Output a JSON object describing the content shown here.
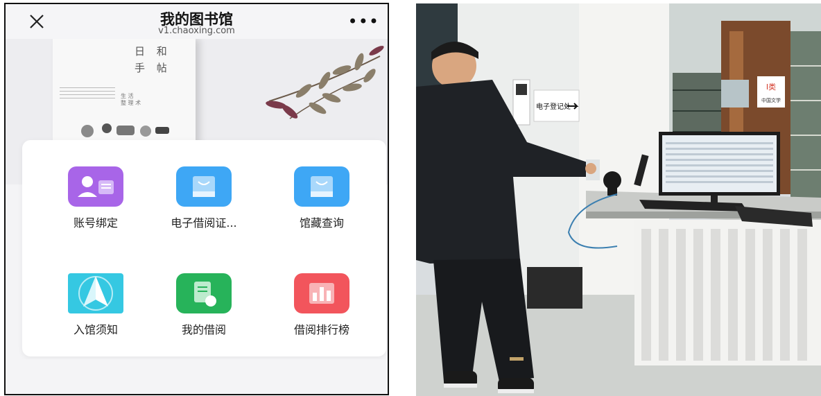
{
  "phone": {
    "title": "我的图书馆",
    "subtitle": "v1.chaoxing.com",
    "more": "•••",
    "banner": {
      "book_title_line1": "日 和",
      "book_title_line2": "手 帖",
      "book_side_line1": "生 活",
      "book_side_line2": "整 理 术"
    },
    "tiles": [
      {
        "label": "账号绑定",
        "icon": "account-bind-icon",
        "color": "#a865e8"
      },
      {
        "label": "电子借阅证...",
        "icon": "e-card-icon",
        "color": "#3ea7f5"
      },
      {
        "label": "馆藏查询",
        "icon": "collection-search-icon",
        "color": "#3ea7f5"
      },
      {
        "label": "入馆须知",
        "icon": "entry-notice-icon",
        "color": "#35c8e2"
      },
      {
        "label": "我的借阅",
        "icon": "my-borrow-icon",
        "color": "#27b35a"
      },
      {
        "label": "借阅排行榜",
        "icon": "ranking-icon",
        "color": "#f2555c"
      }
    ]
  },
  "photo": {
    "sign_text": "电子登记处",
    "shelf_label_line1": "I类",
    "shelf_label_line2": "中国文学"
  }
}
